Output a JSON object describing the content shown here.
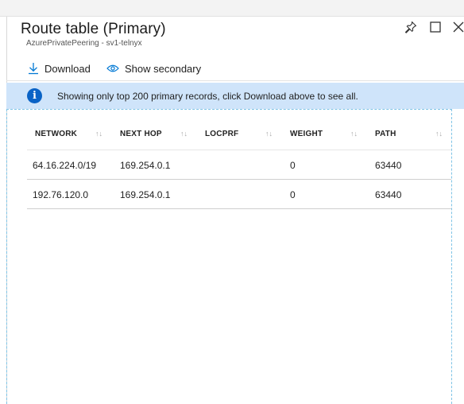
{
  "blade": {
    "title": "Route table (Primary)",
    "subtitle": "AzurePrivatePeering - sv1-telnyx"
  },
  "toolbar": {
    "download_label": "Download",
    "show_secondary_label": "Show secondary"
  },
  "banner": {
    "text": "Showing only top 200 primary records, click Download above to see all."
  },
  "table": {
    "columns": [
      "NETWORK",
      "NEXT HOP",
      "LOCPRF",
      "WEIGHT",
      "PATH"
    ],
    "sort_glyph": "↑↓",
    "rows": [
      [
        "64.16.224.0/19",
        "169.254.0.1",
        "",
        "0",
        "63440"
      ],
      [
        "192.76.120.0",
        "169.254.0.1",
        "",
        "0",
        "63440"
      ]
    ]
  },
  "colors": {
    "banner_bg": "#cfe4fa",
    "info_icon": "#0a63c6",
    "accent": "#0078d4"
  },
  "icons": [
    "pin-icon",
    "maximize-icon",
    "close-icon",
    "download-icon",
    "eye-icon",
    "info-icon",
    "sort-icon"
  ]
}
